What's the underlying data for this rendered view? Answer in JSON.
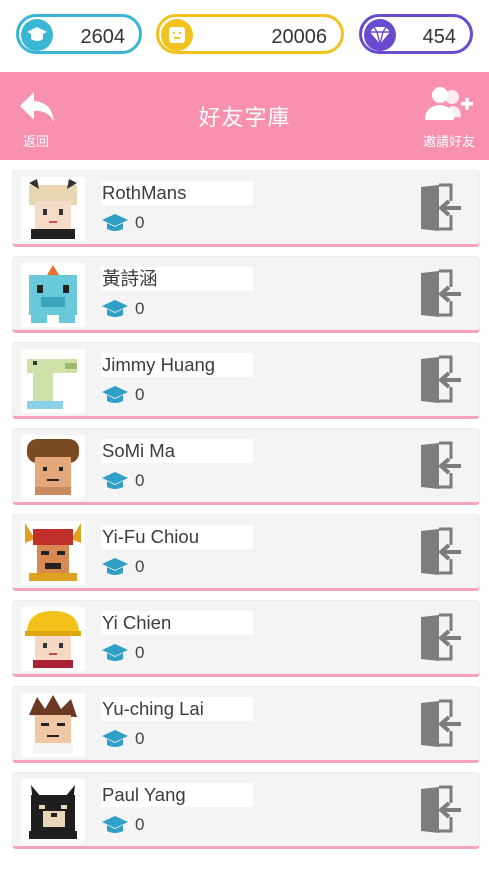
{
  "currency": {
    "scholar": {
      "icon": "graduation-cap-icon",
      "value": "2604",
      "color": "#38b6d4"
    },
    "coins": {
      "icon": "coin-face-icon",
      "value": "20006",
      "color": "#f3c21d"
    },
    "gems": {
      "icon": "diamond-icon",
      "value": "454",
      "color": "#6a4bd0"
    }
  },
  "header": {
    "title": "好友字庫",
    "back_label": "返回",
    "invite_label": "邀請好友",
    "color": "#f890b0"
  },
  "friends": [
    {
      "name": "RothMans",
      "score": "0",
      "avatar": "avatar-cat-ears-girl"
    },
    {
      "name": "黃詩涵",
      "score": "0",
      "avatar": "avatar-blue-creature"
    },
    {
      "name": "Jimmy Huang",
      "score": "0",
      "avatar": "avatar-green-crocodile"
    },
    {
      "name": "SoMi Ma",
      "score": "0",
      "avatar": "avatar-curly-hair"
    },
    {
      "name": "Yi-Fu Chiou",
      "score": "0",
      "avatar": "avatar-warrior"
    },
    {
      "name": "Yi Chien",
      "score": "0",
      "avatar": "avatar-hard-hat"
    },
    {
      "name": "Yu-ching Lai",
      "score": "0",
      "avatar": "avatar-spiky-hair"
    },
    {
      "name": "Paul Yang",
      "score": "0",
      "avatar": "avatar-black-dog"
    }
  ]
}
